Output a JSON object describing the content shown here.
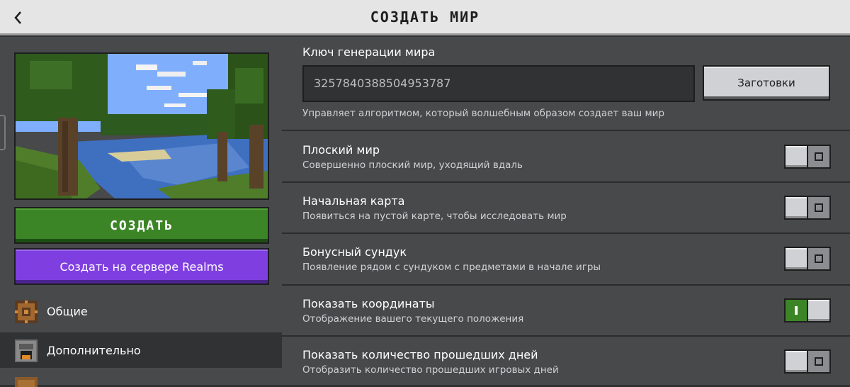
{
  "header": {
    "title": "СОЗДАТЬ МИР"
  },
  "left": {
    "create_label": "СОЗДАТЬ",
    "realms_label": "Создать на сервере Realms",
    "nav": [
      {
        "label": "Общие",
        "icon": "gear-icon"
      },
      {
        "label": "Дополнительно",
        "icon": "furnace-icon"
      },
      {
        "label": "",
        "icon": "chest-icon"
      }
    ]
  },
  "seed": {
    "label": "Ключ генерации мира",
    "value": "3257840388504953787",
    "presets_label": "Заготовки",
    "description": "Управляет алгоритмом, который волшебным образом создает ваш мир"
  },
  "options": [
    {
      "title": "Плоский мир",
      "desc": "Совершенно плоский мир, уходящий вдаль",
      "on": false
    },
    {
      "title": "Начальная карта",
      "desc": "Появиться на пустой карте, чтобы исследовать мир",
      "on": false
    },
    {
      "title": "Бонусный сундук",
      "desc": "Появление рядом с сундуком с предметами в начале игры",
      "on": false
    },
    {
      "title": "Показать координаты",
      "desc": "Отображение вашего текущего положения",
      "on": true
    },
    {
      "title": "Показать количество прошедших дней",
      "desc": "Отобразить количество прошедших игровых дней",
      "on": false
    }
  ],
  "colors": {
    "toggle_on": "#3c8527",
    "create_button": "#3c8527",
    "realms_button": "#7f3fe0",
    "panel": "#48494a"
  }
}
